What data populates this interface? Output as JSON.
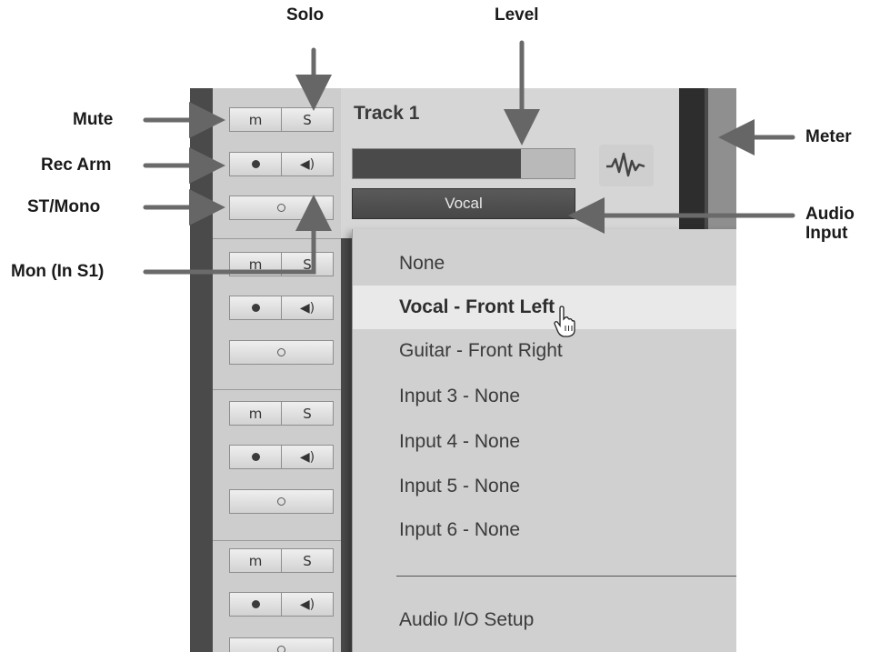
{
  "callouts": {
    "solo": "Solo",
    "level": "Level",
    "mute": "Mute",
    "rec_arm": "Rec Arm",
    "st_mono": "ST/Mono",
    "mon": "Mon (In S1)",
    "meter": "Meter",
    "audio_input_line1": "Audio",
    "audio_input_line2": "Input"
  },
  "track": {
    "title": "Track 1",
    "level_fraction": 0.76,
    "input_value": "Vocal"
  },
  "track_buttons": {
    "mute_label": "m",
    "solo_label": "S",
    "monitor_icon": "speaker-icon",
    "rec_icon": "record-dot-icon",
    "stereo_mono_icon": "ring-icon"
  },
  "dropdown": {
    "items": [
      "None",
      "Vocal - Front Left",
      "Guitar - Front Right",
      "Input 3 - None",
      "Input 4 - None",
      "Input 5 - None",
      "Input 6 - None"
    ],
    "selected_index": 1,
    "footer_item": "Audio I/O Setup"
  },
  "colors": {
    "panel_dark": "#4a4a4a",
    "button_face": "#e2e2e2",
    "menu_highlight": "#e9e9e9"
  }
}
